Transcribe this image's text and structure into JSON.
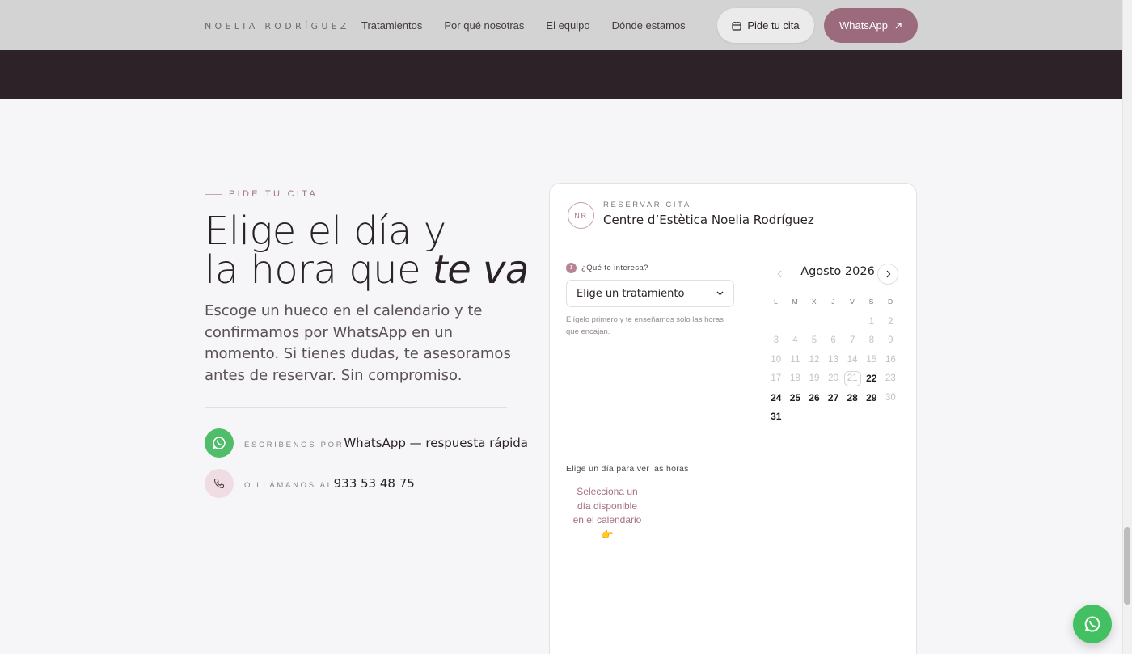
{
  "header": {
    "logo": "NOELIA RODRÍGUEZ",
    "nav": [
      "Tratamientos",
      "Por qué nosotras",
      "El equipo",
      "Dónde estamos"
    ],
    "cta_cita": "Pide tu cita",
    "cta_whatsapp": "WhatsApp"
  },
  "hero": {
    "eyebrow": "PIDE TU CITA",
    "title_line1": "Elige el día y",
    "title_line2a": "la hora que",
    "title_line2b": "te va",
    "lead": "Escoge un hueco en el calendario y te confirmamos por WhatsApp en un momento. Si tienes dudas, te asesoramos antes de reservar. Sin compromiso.",
    "whatsapp_small": "ESCRÍBENOS POR",
    "whatsapp_big": "WhatsApp — respuesta rápida",
    "phone_small": "O LLÁMANOS AL",
    "phone_big": "933 53 48 75"
  },
  "booking": {
    "badge": "NR",
    "kicker": "RESERVAR CITA",
    "name": "Centre d’Estètica Noelia Rodríguez",
    "step_num": "1",
    "step_label": "¿Qué te interesa?",
    "select_value": "Elige un tratamiento",
    "helper": "Elígelo primero y te enseñamos solo las horas que encajan.",
    "month": "Agosto 2026",
    "weekdays": [
      "L",
      "M",
      "X",
      "J",
      "V",
      "S",
      "D"
    ],
    "leading_blanks": 5,
    "days": [
      {
        "d": "1",
        "s": "off"
      },
      {
        "d": "2",
        "s": "off"
      },
      {
        "d": "3",
        "s": "off"
      },
      {
        "d": "4",
        "s": "off"
      },
      {
        "d": "5",
        "s": "off"
      },
      {
        "d": "6",
        "s": "off"
      },
      {
        "d": "7",
        "s": "off"
      },
      {
        "d": "8",
        "s": "off"
      },
      {
        "d": "9",
        "s": "off"
      },
      {
        "d": "10",
        "s": "off"
      },
      {
        "d": "11",
        "s": "off"
      },
      {
        "d": "12",
        "s": "off"
      },
      {
        "d": "13",
        "s": "off"
      },
      {
        "d": "14",
        "s": "off"
      },
      {
        "d": "15",
        "s": "off"
      },
      {
        "d": "16",
        "s": "off"
      },
      {
        "d": "17",
        "s": "off"
      },
      {
        "d": "18",
        "s": "off"
      },
      {
        "d": "19",
        "s": "off"
      },
      {
        "d": "20",
        "s": "off"
      },
      {
        "d": "21",
        "s": "today"
      },
      {
        "d": "22",
        "s": "av"
      },
      {
        "d": "23",
        "s": "off"
      },
      {
        "d": "24",
        "s": "av"
      },
      {
        "d": "25",
        "s": "av"
      },
      {
        "d": "26",
        "s": "av"
      },
      {
        "d": "27",
        "s": "av"
      },
      {
        "d": "28",
        "s": "av"
      },
      {
        "d": "29",
        "s": "av"
      },
      {
        "d": "30",
        "s": "off"
      },
      {
        "d": "31",
        "s": "av"
      }
    ],
    "slots_label": "Elige un día para ver las horas",
    "slots_msg": "Selecciona un día disponible en el calendario 👉"
  },
  "colors": {
    "accent": "#9b6a7c",
    "whatsapp": "#43c162",
    "dark_band": "#2d2228"
  },
  "icons": {
    "calendar": "calendar-icon",
    "arrow": "arrow-up-right-icon",
    "whatsapp": "whatsapp-icon",
    "phone": "phone-icon",
    "chevron": "chevron-down-icon"
  }
}
